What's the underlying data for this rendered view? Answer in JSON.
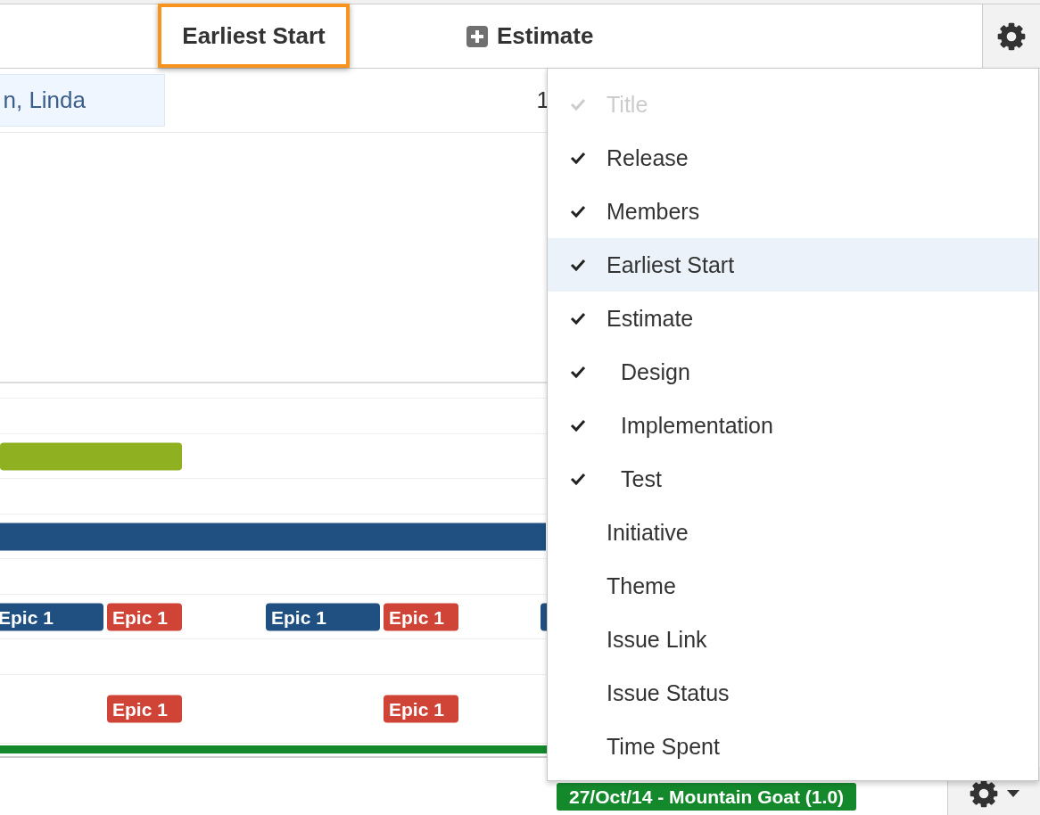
{
  "header": {
    "columns": [
      {
        "label": "Earliest Start",
        "highlighted": true,
        "expandable": false
      },
      {
        "label": "Estimate",
        "highlighted": false,
        "expandable": true
      }
    ]
  },
  "member_row": {
    "member": "n, Linda",
    "value": "1"
  },
  "timeline": [
    {
      "kind": "bar",
      "color": "#8eb021"
    },
    {
      "kind": "bar",
      "color": "#205081"
    },
    {
      "kind": "tags",
      "tags": [
        {
          "label": "Epic 1",
          "color": "#205081"
        },
        {
          "label": "Epic 1",
          "color": "#d04437"
        },
        {
          "label": "Epic 1",
          "color": "#205081"
        },
        {
          "label": "Epic 1",
          "color": "#d04437"
        },
        {
          "color": "#205081"
        }
      ]
    },
    {
      "kind": "tags",
      "tags": [
        {
          "label": "Epic 1",
          "color": "#d04437"
        },
        {
          "label": "Epic 1",
          "color": "#d04437"
        }
      ]
    }
  ],
  "release": {
    "label": "27/Oct/14 - Mountain Goat (1.0)"
  },
  "column_menu": {
    "items": [
      {
        "label": "Title",
        "checked": true,
        "disabled": true,
        "selected": false
      },
      {
        "label": "Release",
        "checked": true,
        "disabled": false,
        "selected": false
      },
      {
        "label": "Members",
        "checked": true,
        "disabled": false,
        "selected": false
      },
      {
        "label": "Earliest Start",
        "checked": true,
        "disabled": false,
        "selected": true
      },
      {
        "label": "Estimate",
        "checked": true,
        "disabled": false,
        "selected": false,
        "children": [
          {
            "label": "Design",
            "checked": true,
            "disabled": false,
            "selected": false
          },
          {
            "label": "Implementation",
            "checked": true,
            "disabled": false,
            "selected": false
          },
          {
            "label": "Test",
            "checked": true,
            "disabled": false,
            "selected": false
          }
        ]
      },
      {
        "label": "Initiative",
        "checked": false,
        "disabled": false,
        "selected": false
      },
      {
        "label": "Theme",
        "checked": false,
        "disabled": false,
        "selected": false
      },
      {
        "label": "Issue Link",
        "checked": false,
        "disabled": false,
        "selected": false
      },
      {
        "label": "Issue Status",
        "checked": false,
        "disabled": false,
        "selected": false
      },
      {
        "label": "Time Spent",
        "checked": false,
        "disabled": false,
        "selected": false
      }
    ]
  }
}
